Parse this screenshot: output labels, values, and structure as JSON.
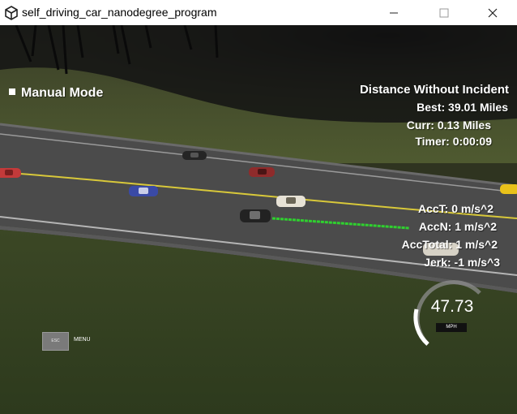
{
  "window": {
    "title": "self_driving_car_nanodegree_program",
    "minimize_icon": "minimize-icon",
    "maximize_icon": "maximize-icon",
    "close_icon": "close-icon",
    "app_icon": "unity-logo-icon"
  },
  "hud": {
    "mode_label": "Manual Mode",
    "distance_heading": "Distance Without Incident",
    "best": "Best: 39.01 Miles",
    "curr": "Curr: 0.13 Miles",
    "timer": "Timer: 0:00:09",
    "acc_t": "AccT: 0 m/s^2",
    "acc_n": "AccN: 1 m/s^2",
    "acc_total": "AccTotal: 1 m/s^2",
    "jerk": "Jerk: -1 m/s^3",
    "esc_label": "ESC",
    "menu_label": "MENU"
  },
  "speedometer": {
    "value": "47.73",
    "unit": "MPH",
    "fill_fraction": 0.5
  },
  "colors": {
    "path_line": "#2fd12f",
    "lane_marking": "#d8c83a"
  }
}
